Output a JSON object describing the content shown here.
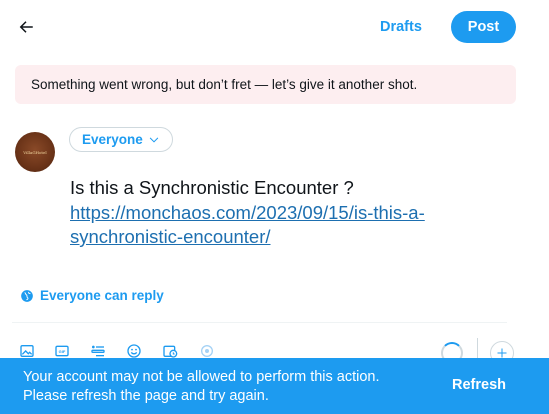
{
  "header": {
    "back_icon": "arrow-left-icon",
    "drafts_label": "Drafts",
    "post_label": "Post"
  },
  "error_banner": {
    "text": "Something went wrong, but don’t fret — let’s give it another shot."
  },
  "composer": {
    "avatar_text": "VillaGHotel",
    "audience_label": "Everyone",
    "text_prefix": "Is this a Synchronistic Encounter ?",
    "link_line1": "https://monchaos.com/2023/09/15/is-this-a-",
    "link_line2": "synchronistic-encounter/",
    "reply_setting_label": "Everyone can reply"
  },
  "toolbar": {
    "icons": [
      "image-icon",
      "gif-icon",
      "poll-icon",
      "emoji-icon",
      "schedule-icon",
      "location-icon"
    ]
  },
  "toast": {
    "line1": "Your account may not be allowed to perform this action.",
    "line2": "Please refresh the page and try again.",
    "action_label": "Refresh"
  },
  "colors": {
    "accent": "#1d9bf0",
    "error_bg": "#fdeef0",
    "text": "#0f1419"
  }
}
